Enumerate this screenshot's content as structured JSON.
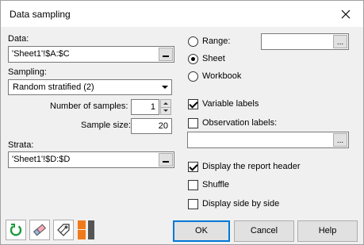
{
  "window": {
    "title": "Data sampling",
    "close_label": "✕"
  },
  "data_section": {
    "label": "Data:",
    "value": "'Sheet1'!$A:$C"
  },
  "sampling": {
    "label": "Sampling:",
    "selected": "Random stratified (2)"
  },
  "num_samples": {
    "label": "Number of samples:",
    "value": "1"
  },
  "sample_size": {
    "label": "Sample size:",
    "value": "20"
  },
  "strata": {
    "label": "Strata:",
    "value": "'Sheet1'!$D:$D"
  },
  "range_options": {
    "range": {
      "label": "Range:",
      "selected": false,
      "value": ""
    },
    "sheet": {
      "label": "Sheet",
      "selected": true
    },
    "workbook": {
      "label": "Workbook",
      "selected": false
    }
  },
  "options": {
    "variable_labels": {
      "label": "Variable labels",
      "checked": true
    },
    "observation_labels": {
      "label": "Observation labels:",
      "checked": false,
      "value": ""
    },
    "display_report_header": {
      "label": "Display the report header",
      "checked": true
    },
    "shuffle": {
      "label": "Shuffle",
      "checked": false
    },
    "display_side_by_side": {
      "label": "Display side by side",
      "checked": false
    }
  },
  "toolbar_icons": [
    "reset-icon",
    "eraser-icon",
    "tag-icon",
    "color-palette-icon"
  ],
  "buttons": {
    "ok": "OK",
    "cancel": "Cancel",
    "help": "Help"
  },
  "colors": {
    "titlebar_bg": "#ffffff",
    "dialog_bg": "#f0f0f0",
    "reset_green": "#1a9a3a",
    "palette_orange": "#f07a1a",
    "palette_dark": "#555555"
  }
}
